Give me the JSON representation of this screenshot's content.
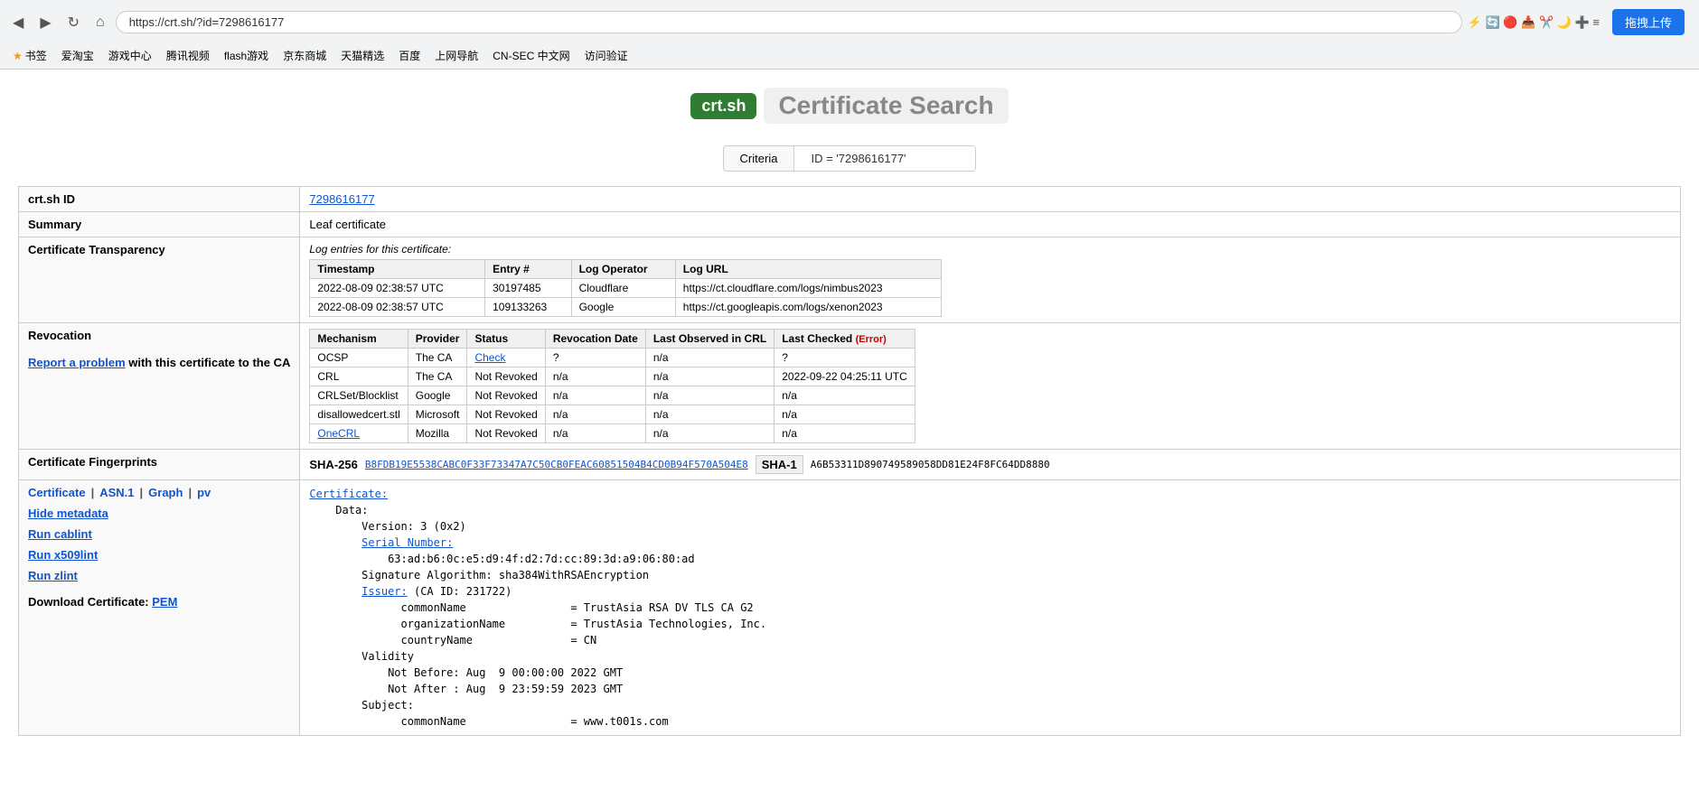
{
  "browser": {
    "url": "https://crt.sh/?id=7298616177",
    "nav_back": "◀",
    "nav_forward": "▶",
    "nav_refresh": "↻",
    "nav_home": "⌂",
    "upload_btn": "拖拽上传",
    "bookmarks": [
      {
        "label": "书签",
        "icon": "★"
      },
      {
        "label": "爱淘宝"
      },
      {
        "label": "游戏中心"
      },
      {
        "label": "腾讯视频"
      },
      {
        "label": "flash游戏"
      },
      {
        "label": "京东商城"
      },
      {
        "label": "天猫精选"
      },
      {
        "label": "百度"
      },
      {
        "label": "上网导航"
      },
      {
        "label": "CN-SEC 中文网"
      },
      {
        "label": "访问验证"
      }
    ]
  },
  "header": {
    "logo": "crt.sh",
    "title": "Certificate Search"
  },
  "search": {
    "criteria_label": "Criteria",
    "id_value": "ID = '7298616177'"
  },
  "fields": {
    "crtsh_id_label": "crt.sh ID",
    "crtsh_id_value": "7298616177",
    "summary_label": "Summary",
    "summary_value": "Leaf certificate",
    "ct_label": "Certificate Transparency",
    "ct_intro": "Log entries for this certificate:",
    "ct_columns": [
      "Timestamp",
      "Entry #",
      "Log Operator",
      "Log URL"
    ],
    "ct_rows": [
      {
        "timestamp": "2022-08-09 02:38:57 UTC",
        "entry": "30197485",
        "operator": "Cloudflare",
        "url": "https://ct.cloudflare.com/logs/nimbus2023"
      },
      {
        "timestamp": "2022-08-09 02:38:57 UTC",
        "entry": "109133263",
        "operator": "Google",
        "url": "https://ct.googleapis.com/logs/xenon2023"
      }
    ],
    "revocation_label": "Revocation",
    "report_link": "Report a problem",
    "report_text": " with this certificate to the CA",
    "rev_columns": [
      "Mechanism",
      "Provider",
      "Status",
      "Revocation Date",
      "Last Observed in CRL",
      "Last Checked"
    ],
    "rev_error": "(Error)",
    "rev_rows": [
      {
        "mechanism": "OCSP",
        "provider": "The CA",
        "status": "Check",
        "status_link": true,
        "rev_date": "?",
        "last_obs": "n/a",
        "last_checked": "?"
      },
      {
        "mechanism": "CRL",
        "provider": "The CA",
        "status": "Not Revoked",
        "status_link": false,
        "rev_date": "n/a",
        "last_obs": "n/a",
        "last_checked": "2022-09-22  04:25:11 UTC"
      },
      {
        "mechanism": "CRLSet/Blocklist",
        "provider": "Google",
        "status": "Not Revoked",
        "status_link": false,
        "rev_date": "n/a",
        "last_obs": "n/a",
        "last_checked": "n/a"
      },
      {
        "mechanism": "disallowedcert.stl",
        "provider": "Microsoft",
        "status": "Not Revoked",
        "status_link": false,
        "rev_date": "n/a",
        "last_obs": "n/a",
        "last_checked": "n/a"
      },
      {
        "mechanism": "OneCRL",
        "provider": "Mozilla",
        "status": "Not Revoked",
        "status_link": false,
        "rev_date": "n/a",
        "last_obs": "n/a",
        "last_checked": "n/a"
      }
    ],
    "fp_label": "Certificate Fingerprints",
    "sha256_label": "SHA-256",
    "sha256_value": "B8FDB19E5538CABC0F33F73347A7C50CB0FEAC60851504B4CD0B94F570A504E8",
    "sha1_label": "SHA-1",
    "sha1_value": "A6B53311D890749589058DD81E24F8FC64DD8880",
    "cert_label": "Certificate",
    "asn1_label": "ASN.1",
    "graph_label": "Graph",
    "pv_label": "pv",
    "hide_metadata": "Hide metadata",
    "run_cablint": "Run cablint",
    "run_x509lint": "Run x509lint",
    "run_zlint": "Run zlint",
    "download_label": "Download Certificate:",
    "pem_label": "PEM",
    "cert_content": "Certificate:\n    Data:\n        Version: 3 (0x2)\n        Serial Number:\n            63:ad:b6:0c:e5:d9:4f:d2:7d:cc:89:3d:a9:06:80:ad\n        Signature Algorithm: sha384WithRSAEncryption\n        Issuer: (CA ID: 231722)\n              commonName                = TrustAsia RSA DV TLS CA G2\n              organizationName          = TrustAsia Technologies, Inc.\n              countryName               = CN\n        Validity\n            Not Before: Aug  9 00:00:00 2022 GMT\n            Not After : Aug  9 23:59:59 2023 GMT\n        Subject:\n              commonName                = www.t001s.com"
  }
}
